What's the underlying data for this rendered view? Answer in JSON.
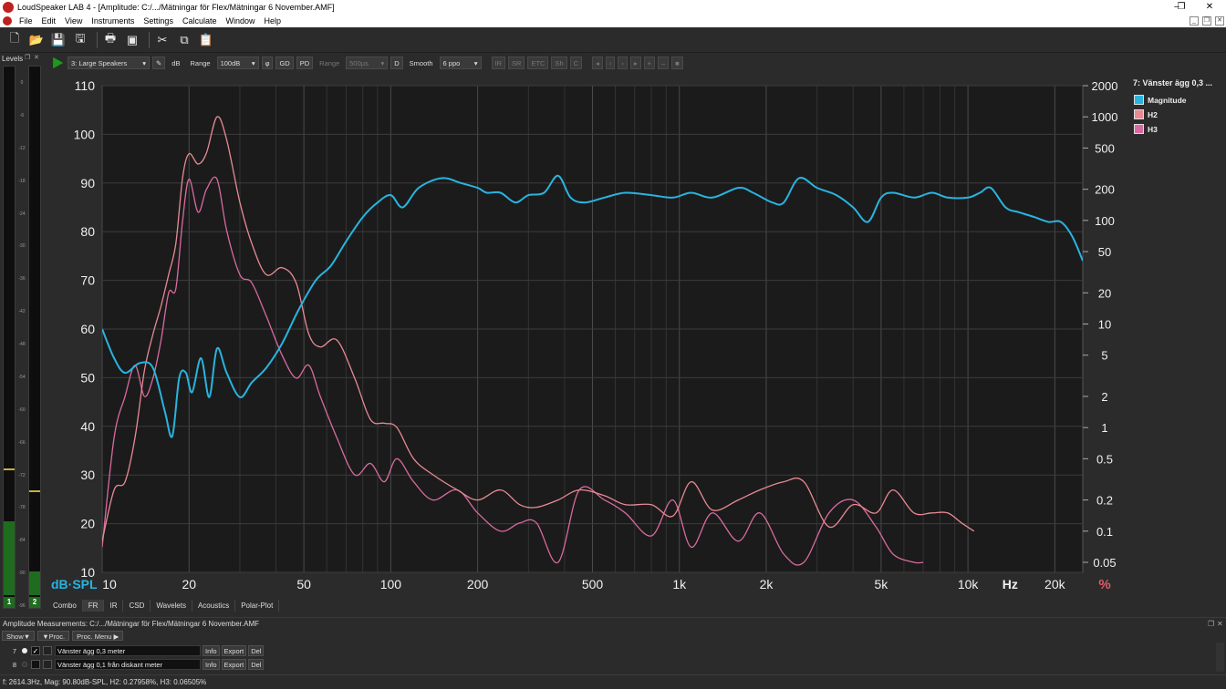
{
  "window": {
    "title": "LoudSpeaker LAB 4 - [Amplitude: C:/.../Mätningar för Flex/Mätningar 6 November.AMF]",
    "minimize": "–",
    "restore": "❐",
    "close": "✕"
  },
  "menu": [
    "File",
    "Edit",
    "View",
    "Instruments",
    "Settings",
    "Calculate",
    "Window",
    "Help"
  ],
  "levels": {
    "title": "Levels",
    "scale": [
      "0",
      "-6",
      "-12",
      "-18",
      "-24",
      "-30",
      "-36",
      "-42",
      "-48",
      "-54",
      "-60",
      "-66",
      "-72",
      "-78",
      "-84",
      "-90",
      "-96"
    ],
    "channels": [
      {
        "label": "1",
        "level": 0.14,
        "peak": 0.235
      },
      {
        "label": "2",
        "level": 0.045,
        "peak": 0.195
      }
    ]
  },
  "toolbar2": {
    "preset": "3: Large Speakers",
    "db": "dB",
    "range_label": "Range",
    "range_value": "100dB",
    "phi": "φ",
    "gd": "GD",
    "pd": "PD",
    "range2_label": "Range",
    "range2_value": "500µs",
    "d": "D",
    "smooth_label": "Smooth",
    "smooth_value": "6 ppo",
    "ir": "IR",
    "sr": "SR",
    "etc": "ETC",
    "sh": "Sh",
    "c": "C"
  },
  "chart_data": {
    "type": "line",
    "x_scale": "log",
    "xlim": [
      10,
      25000
    ],
    "x_ticks": [
      10,
      20,
      50,
      100,
      200,
      500,
      1000,
      2000,
      5000,
      10000,
      20000
    ],
    "x_tick_labels": [
      "10",
      "20",
      "50",
      "100",
      "200",
      "500",
      "1k",
      "2k",
      "5k",
      "10k",
      "20k"
    ],
    "xlabel": "Hz",
    "ylabel": "dB·SPL",
    "ylim": [
      10,
      110
    ],
    "y_ticks": [
      10,
      20,
      30,
      40,
      50,
      60,
      70,
      80,
      90,
      100,
      110
    ],
    "y2_label": "%",
    "y2_scale": "log",
    "y2lim": [
      0.04,
      2000
    ],
    "y2_ticks": [
      0.05,
      0.1,
      0.2,
      0.5,
      1,
      2,
      5,
      10,
      20,
      50,
      100,
      200,
      500,
      1000,
      2000
    ],
    "y2_tick_labels": [
      "0.05",
      "0.1",
      "0.2",
      "0.5",
      "1",
      "2",
      "5",
      "10",
      "20",
      "50",
      "100",
      "200",
      "500",
      "1000",
      "2000"
    ],
    "grid": true,
    "series": [
      {
        "name": "Magnitude",
        "color": "#29b4e0",
        "axis": "left",
        "x": [
          10,
          11,
          12,
          13.5,
          15,
          16.5,
          17.5,
          18.5,
          19.5,
          20.5,
          22,
          23.5,
          25,
          27,
          30,
          33,
          37,
          42,
          48,
          55,
          62,
          70,
          80,
          90,
          100,
          110,
          125,
          150,
          175,
          200,
          215,
          240,
          270,
          300,
          340,
          380,
          420,
          470,
          550,
          650,
          800,
          950,
          1100,
          1300,
          1600,
          1800,
          2100,
          2300,
          2600,
          3000,
          3500,
          4000,
          4500,
          5000,
          5500,
          6500,
          7500,
          8500,
          10000,
          11000,
          12000,
          13500,
          15000,
          17000,
          19000,
          21000,
          23000,
          25000
        ],
        "y": [
          60,
          54,
          51,
          53,
          52,
          43,
          38,
          50,
          51,
          47,
          54,
          46,
          56,
          51,
          46,
          49,
          52,
          57,
          64,
          70,
          73,
          78,
          83,
          86,
          87.5,
          85,
          89,
          91,
          90,
          89,
          88,
          88,
          86,
          87.5,
          88,
          91.5,
          87,
          86,
          87,
          88,
          87.5,
          87,
          88,
          87,
          89,
          88,
          86,
          86,
          91,
          89,
          87.5,
          85,
          82,
          87,
          88,
          87,
          88,
          87,
          87,
          88,
          89,
          85,
          84,
          83,
          82,
          82,
          79,
          74
        ]
      },
      {
        "name": "H2",
        "color": "#e88a94",
        "axis": "right",
        "x": [
          10,
          11,
          12,
          13,
          14,
          15,
          16,
          17,
          18,
          19,
          20,
          21.5,
          23,
          25,
          27,
          30,
          33,
          37,
          42,
          47,
          52,
          57,
          65,
          75,
          85,
          95,
          105,
          120,
          140,
          170,
          200,
          240,
          280,
          320,
          380,
          450,
          550,
          650,
          800,
          950,
          1100,
          1300,
          1600,
          1900,
          2300,
          2700,
          3300,
          4000,
          4800,
          5500,
          6500,
          7500,
          8500,
          9500,
          10500
        ],
        "y": [
          0.08,
          0.25,
          0.3,
          0.8,
          3.5,
          8,
          15,
          30,
          60,
          260,
          440,
          350,
          450,
          1000,
          600,
          150,
          60,
          30,
          35,
          25,
          8,
          6,
          7,
          3,
          1.2,
          1.1,
          1.0,
          0.5,
          0.35,
          0.25,
          0.2,
          0.25,
          0.18,
          0.17,
          0.2,
          0.25,
          0.22,
          0.18,
          0.18,
          0.14,
          0.3,
          0.16,
          0.2,
          0.25,
          0.3,
          0.3,
          0.11,
          0.18,
          0.15,
          0.25,
          0.15,
          0.15,
          0.15,
          0.12,
          0.1
        ]
      },
      {
        "name": "H3",
        "color": "#d96aa0",
        "axis": "right",
        "x": [
          10,
          11,
          12,
          13,
          14,
          15,
          16,
          17,
          18,
          19,
          20,
          21.5,
          23,
          25,
          27,
          30,
          33,
          37,
          42,
          47,
          52,
          57,
          65,
          75,
          85,
          95,
          105,
          120,
          140,
          170,
          200,
          240,
          280,
          320,
          380,
          450,
          550,
          650,
          800,
          950,
          1100,
          1300,
          1600,
          1900,
          2300,
          2700,
          3300,
          4000,
          4800,
          5500,
          6500,
          7000
        ],
        "y": [
          0.07,
          0.8,
          2,
          4,
          2,
          3,
          7,
          20,
          22,
          100,
          250,
          120,
          200,
          250,
          80,
          30,
          25,
          12,
          5,
          3,
          4,
          2,
          0.8,
          0.35,
          0.45,
          0.3,
          0.5,
          0.3,
          0.2,
          0.25,
          0.15,
          0.1,
          0.12,
          0.12,
          0.05,
          0.25,
          0.2,
          0.15,
          0.09,
          0.2,
          0.07,
          0.15,
          0.08,
          0.15,
          0.06,
          0.05,
          0.15,
          0.2,
          0.11,
          0.06,
          0.05,
          0.05
        ]
      }
    ]
  },
  "legend": {
    "title": "7: Vänster ägg 0,3 ...",
    "items": [
      {
        "label": "Magnitude",
        "color": "#29b4e0"
      },
      {
        "label": "H2",
        "color": "#e88a94"
      },
      {
        "label": "H3",
        "color": "#d96aa0"
      }
    ]
  },
  "bottom_tabs": [
    "Combo",
    "FR",
    "IR",
    "CSD",
    "Wavelets",
    "Acoustics",
    "Polar-Plot"
  ],
  "measurements": {
    "header": "Amplitude Measurements: C:/.../Mätningar för Flex/Mätningar 6 November.AMF",
    "show": "Show▼",
    "proc": "▼Proc.",
    "proc_menu": "Proc. Menu ▶",
    "rows": [
      {
        "num": "7",
        "name": "Vänster ägg 0,3 meter",
        "checked": "✓",
        "info": "Info",
        "export": "Export",
        "del": "Del"
      },
      {
        "num": "8",
        "name": "Vänster ägg 0,1 från diskant meter",
        "checked": "",
        "info": "Info",
        "export": "Export",
        "del": "Del"
      }
    ]
  },
  "status": "f: 2614.3Hz, Mag: 90.80dB-SPL, H2: 0.27958%, H3: 0.06505%"
}
